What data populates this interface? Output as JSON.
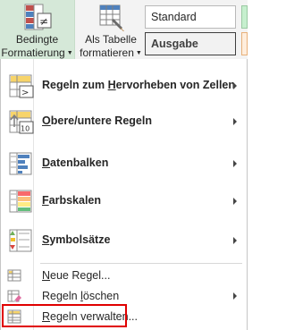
{
  "ribbon": {
    "conditional_formatting": {
      "line1": "Bedingte",
      "line2": "Formatierung"
    },
    "format_as_table": {
      "line1": "Als Tabelle",
      "line2": "formatieren"
    },
    "styles": {
      "standard": "Standard",
      "output": "Ausgabe"
    }
  },
  "menu": {
    "items": [
      {
        "pre": "Regeln zum ",
        "key": "H",
        "post": "ervorheben von Zellen",
        "icon": "highlight-cells-rules-icon",
        "has_submenu": true
      },
      {
        "pre": "",
        "key": "O",
        "post": "bere/untere Regeln",
        "icon": "top-bottom-rules-icon",
        "has_submenu": true,
        "icon_text": "10"
      },
      {
        "pre": "",
        "key": "D",
        "post": "atenbalken",
        "icon": "data-bars-icon",
        "has_submenu": true
      },
      {
        "pre": "",
        "key": "F",
        "post": "arbskalen",
        "icon": "color-scales-icon",
        "has_submenu": true
      },
      {
        "pre": "",
        "key": "S",
        "post": "ymbolsätze",
        "icon": "icon-sets-icon",
        "has_submenu": true
      },
      {
        "pre": "",
        "key": "N",
        "post": "eue Regel...",
        "icon": "new-rule-icon",
        "has_submenu": false
      },
      {
        "pre": "Regeln ",
        "key": "l",
        "post": "öschen",
        "icon": "clear-rules-icon",
        "has_submenu": true
      },
      {
        "pre": "",
        "key": "R",
        "post": "egeln verwalten...",
        "icon": "manage-rules-icon",
        "has_submenu": false
      }
    ]
  },
  "colors": {
    "selected_ribbon": "#d5e8d8",
    "highlight_frame": "#e00000"
  }
}
